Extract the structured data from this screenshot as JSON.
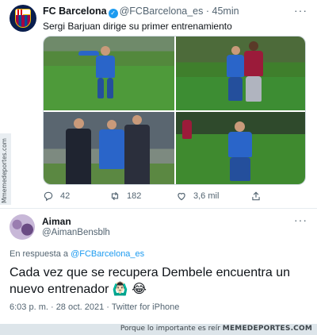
{
  "tweet": {
    "name": "FC Barcelona",
    "handle": "@FCBarcelona_es",
    "separator": "·",
    "time": "45min",
    "text": "Sergi Barjuan dirige su primer entrenamiento",
    "replies": "42",
    "retweets": "182",
    "likes": "3,6 mil"
  },
  "reply": {
    "name": "Aiman",
    "handle": "@AimanBensblh",
    "in_reply_prefix": "En respuesta a",
    "in_reply_to": "@FCBarcelona_es",
    "text": "Cada vez que se recupera Dembele encuentra un nuevo entrenador",
    "emoji": "🙆🏻‍♂️ 😂",
    "meta": "6:03 p. m. · 28 oct. 2021 · Twitter for iPhone"
  },
  "watermark": {
    "side": "Mmemedeportes.com",
    "footer_prefix": "Porque lo importante es reír",
    "footer_brand": "MEMEDEPORTES.COM"
  },
  "icons": {
    "verified": "verified-badge-icon",
    "more": "more-options-icon",
    "reply": "reply-icon",
    "retweet": "retweet-icon",
    "like": "like-icon",
    "share": "share-icon"
  },
  "colors": {
    "accent": "#1d9bf0",
    "muted": "#536471",
    "text": "#0f1419"
  }
}
